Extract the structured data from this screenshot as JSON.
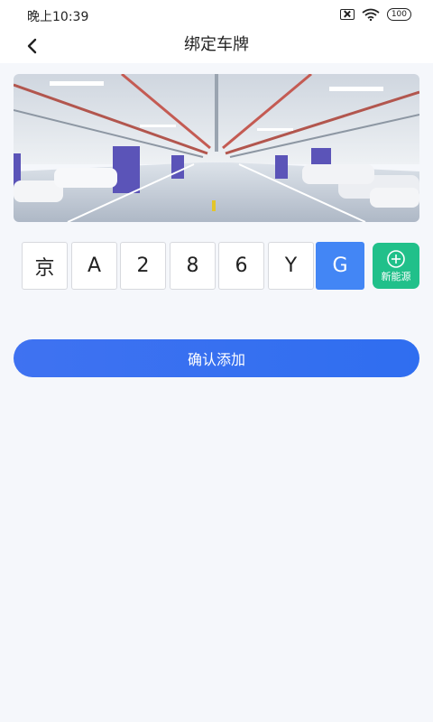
{
  "status_bar": {
    "time": "晚上10:39",
    "battery": "100"
  },
  "header": {
    "title": "绑定车牌"
  },
  "banner": {
    "icon": "parking-garage-photo"
  },
  "plate": {
    "chars": [
      "京",
      "A",
      "2",
      "8",
      "6",
      "Y",
      "G"
    ],
    "active_index": 6,
    "new_energy_label": "新能源"
  },
  "actions": {
    "confirm_label": "确认添加"
  },
  "colors": {
    "accent": "#4386f5",
    "green": "#21c08a",
    "button": "#3a70f0",
    "background": "#f5f7fb"
  }
}
